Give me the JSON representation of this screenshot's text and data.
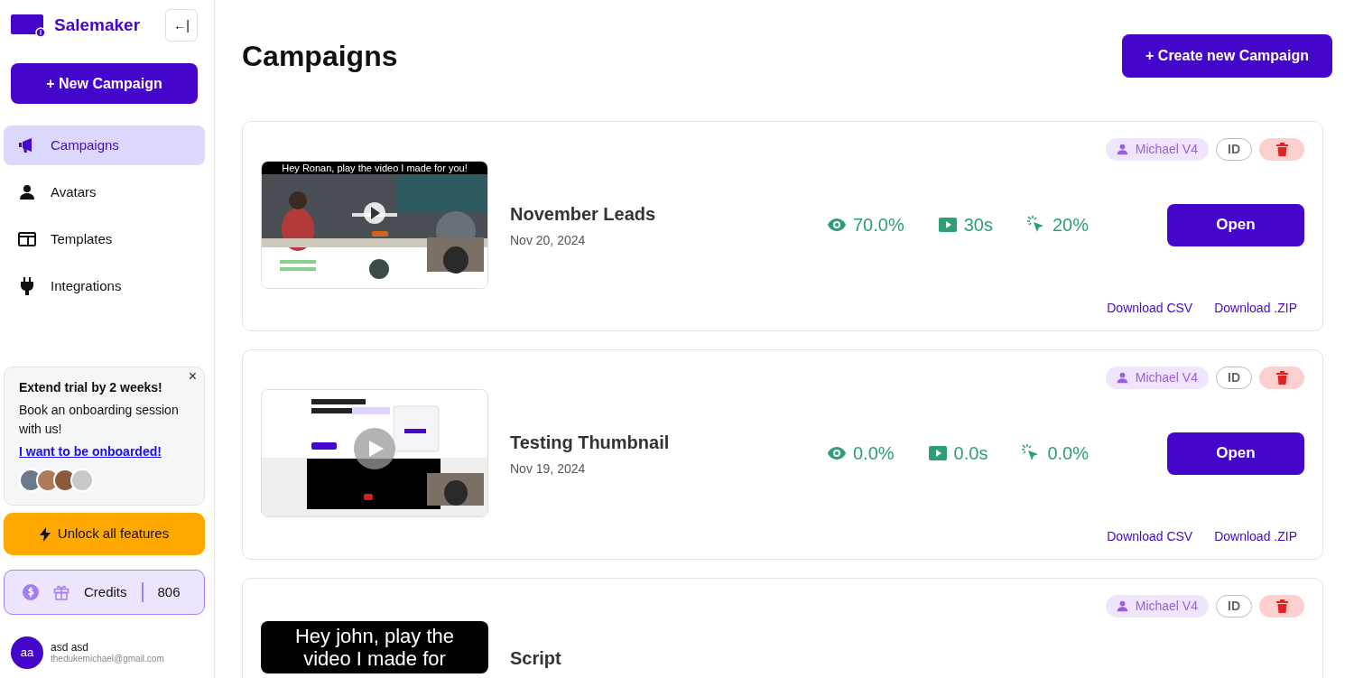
{
  "sidebar": {
    "brand": "Salemaker",
    "collapse_label": "←|",
    "new_button": "+ New Campaign",
    "items": [
      {
        "label": "Campaigns",
        "selected": true
      },
      {
        "label": "Avatars",
        "selected": false
      },
      {
        "label": "Templates",
        "selected": false
      },
      {
        "label": "Integrations",
        "selected": false
      }
    ],
    "promo": {
      "close": "×",
      "title": "Extend trial by 2 weeks!",
      "text": "Book an onboarding session with us!",
      "link": "I want to be onboarded!"
    },
    "unlock_button": "Unlock all features",
    "credits": {
      "label": "Credits",
      "value": "806"
    },
    "user": {
      "initials": "aa",
      "name": "asd asd",
      "email": "thedukemichael@gmail.com"
    }
  },
  "main": {
    "title": "Campaigns",
    "create_button": "+ Create new Campaign",
    "campaigns": [
      {
        "caption": "Hey Ronan, play the video I made for you!",
        "kind": "office",
        "title": "November Leads",
        "date": "Nov 20, 2024",
        "avatar": "Michael V4",
        "id_label": "ID",
        "stats": [
          "70.0%",
          "30s",
          "20%"
        ],
        "open": "Open",
        "downloads": [
          "Download CSV",
          "Download .ZIP"
        ]
      },
      {
        "kind": "site",
        "title": "Testing Thumbnail",
        "date": "Nov 19, 2024",
        "avatar": "Michael V4",
        "id_label": "ID",
        "stats": [
          "0.0%",
          "0.0s",
          "0.0%"
        ],
        "open": "Open",
        "downloads": [
          "Download CSV",
          "Download .ZIP"
        ]
      },
      {
        "caption": "Hey john, play the video I made for",
        "kind": "black",
        "title": "Script",
        "avatar": "Michael V4",
        "id_label": "ID"
      }
    ]
  }
}
